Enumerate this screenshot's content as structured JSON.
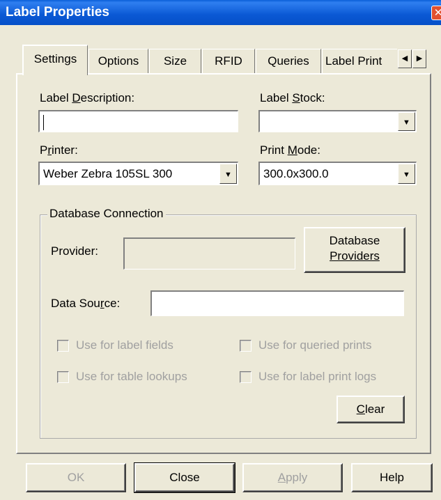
{
  "window": {
    "title": "Label Properties",
    "close_glyph": "✕"
  },
  "tabs": [
    {
      "label": "Settings",
      "active": true
    },
    {
      "label": "Options"
    },
    {
      "label": "Size"
    },
    {
      "label": "RFID"
    },
    {
      "label": "Queries"
    },
    {
      "label": "Label Print"
    }
  ],
  "tab_nav": {
    "left_glyph": "◀",
    "right_glyph": "▶"
  },
  "fields": {
    "label_description": {
      "label_pre": "Label ",
      "label_key": "D",
      "label_post": "escription:",
      "value": ""
    },
    "label_stock": {
      "label_pre": "Label ",
      "label_key": "S",
      "label_post": "tock:",
      "value": ""
    },
    "printer": {
      "label_pre": "P",
      "label_key": "r",
      "label_post": "inter:",
      "value": "Weber Zebra 105SL 300"
    },
    "print_mode": {
      "label_pre": "Print ",
      "label_key": "M",
      "label_post": "ode:",
      "value": "300.0x300.0"
    }
  },
  "dropdown_glyph": "▼",
  "database": {
    "group_title": "Database Connection",
    "provider_label": "Provider:",
    "provider_value": "",
    "providers_button_line1": "Database",
    "providers_button_line2": "Providers",
    "data_source": {
      "label_pre": "Data Sou",
      "label_key": "r",
      "label_post": "ce:",
      "value": ""
    },
    "checkboxes": [
      {
        "label": "Use for label fields",
        "checked": false
      },
      {
        "label": "Use for queried prints",
        "checked": false
      },
      {
        "label": "Use for table lookups",
        "checked": false
      },
      {
        "label": "Use for label print logs",
        "checked": false
      }
    ],
    "clear_button": {
      "key": "C",
      "rest": "lear"
    }
  },
  "buttons": {
    "ok": "OK",
    "close": "Close",
    "apply_key": "A",
    "apply_rest": "pply",
    "help": "Help"
  }
}
